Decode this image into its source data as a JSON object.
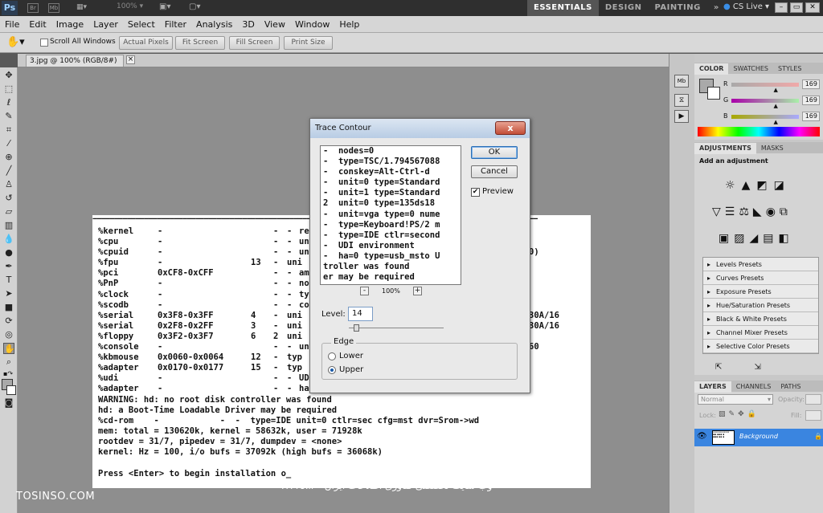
{
  "appbar": {
    "logo": "Ps",
    "zoom": "100%",
    "workspaces": [
      "ESSENTIALS",
      "DESIGN",
      "PAINTING"
    ],
    "more": "»",
    "cslive": "CS Live"
  },
  "menu": [
    "File",
    "Edit",
    "Image",
    "Layer",
    "Select",
    "Filter",
    "Analysis",
    "3D",
    "View",
    "Window",
    "Help"
  ],
  "options": {
    "scroll_all": "Scroll All Windows",
    "buttons": [
      "Actual Pixels",
      "Fit Screen",
      "Fill Screen",
      "Print Size"
    ]
  },
  "doc_tab": {
    "title": "3.jpg @ 100% (RGB/8#)",
    "close": "×"
  },
  "color_panel": {
    "tabs": [
      "COLOR",
      "SWATCHES",
      "STYLES"
    ],
    "channels": [
      {
        "label": "R",
        "value": "169",
        "pos": 0.66
      },
      {
        "label": "G",
        "value": "169",
        "pos": 0.66
      },
      {
        "label": "B",
        "value": "169",
        "pos": 0.66
      }
    ]
  },
  "adjustments": {
    "tabs": [
      "ADJUSTMENTS",
      "MASKS"
    ],
    "heading": "Add an adjustment",
    "presets": [
      "Levels Presets",
      "Curves Presets",
      "Exposure Presets",
      "Hue/Saturation Presets",
      "Black & White Presets",
      "Channel Mixer Presets",
      "Selective Color Presets"
    ]
  },
  "layers": {
    "tabs": [
      "LAYERS",
      "CHANNELS",
      "PATHS"
    ],
    "blend_mode": "Normal",
    "opacity_label": "Opacity:",
    "lock_label": "Lock:",
    "fill_label": "Fill:",
    "layer_name": "Background"
  },
  "terminal": {
    "rows": [
      [
        "%kernel",
        "-",
        "",
        "-",
        "-",
        "rel"
      ],
      [
        "%cpu",
        "-",
        "",
        "-",
        "-",
        "uni"
      ],
      [
        "%cpuid",
        "-",
        "",
        "-",
        "-",
        "uni"
      ],
      [
        "%fpu",
        "-",
        "13",
        "-",
        "uni"
      ],
      [
        "%pci",
        "0xCF8-0xCFF",
        "",
        "-",
        "-",
        "am="
      ],
      [
        "%PnP",
        "-",
        "",
        "-",
        "-",
        "nod"
      ],
      [
        "%clock",
        "-",
        "",
        "-",
        "-",
        "typ"
      ],
      [
        "%scodb",
        "-",
        "",
        "-",
        "-",
        "con"
      ],
      [
        "%serial",
        "0x3F8-0x3FF",
        "4",
        "-",
        "uni"
      ],
      [
        "%serial",
        "0x2F8-0x2FF",
        "3",
        "-",
        "uni"
      ],
      [
        "%floppy",
        "0x3F2-0x3F7",
        "6",
        "2",
        "uni"
      ],
      [
        "%console",
        "-",
        "",
        "-",
        "-",
        "uni"
      ],
      [
        "%kbmouse",
        "0x0060-0x0064",
        "12",
        "-",
        "typ"
      ],
      [
        "%adapter",
        "0x0170-0x0177",
        "15",
        "-",
        "typ"
      ],
      [
        "%udi",
        "-",
        "",
        "-",
        "-",
        "UDI"
      ],
      [
        "%adapter",
        "-",
        "",
        "-",
        "-",
        "ha="
      ]
    ],
    "right_col": [
      "",
      "",
      "0)",
      "",
      "",
      "",
      "",
      "",
      "30A/16",
      "30A/16",
      "",
      "60",
      "",
      "",
      "",
      ""
    ],
    "lines": [
      "WARNING: hd: no root disk controller was found",
      "hd: a Boot-Time Loadable Driver may be required",
      "%cd-rom    -            -  -  type=IDE unit=0 ctlr=sec cfg=mst dvr=Srom->wd",
      "mem: total = 130620k, kernel = 58632k, user = 71928k",
      "rootdev = 31/7, pipedev = 31/7, dumpdev = <none>",
      "kernel: Hz = 100, i/o bufs = 37092k (high bufs = 36068k)",
      "",
      "Press <Enter> to begin installation o_"
    ]
  },
  "watermark": {
    "left": "TOSINSO.COM",
    "right": "وب سایت تخصصی فناوری اطلاعات ایران - ITPro.ir"
  },
  "dialog": {
    "title": "Trace Contour",
    "close": "x",
    "ok": "OK",
    "cancel": "Cancel",
    "preview_label": "Preview",
    "preview_lines": [
      "-  nodes=0",
      "-  type=TSC/1.794567088",
      "-  conskey=Alt-Ctrl-d",
      "-  unit=0 type=Standard",
      "-  unit=1 type=Standard",
      "2  unit=0 type=135ds18",
      "-  unit=vga type=0 nume",
      "-  type=Keyboard!PS/2 m",
      "-  type=IDE ctlr=second",
      "-  UDI environment",
      "-  ha=0 type=usb_msto U",
      "troller was found",
      "er may be required"
    ],
    "zoom": "100%",
    "minus": "-",
    "plus": "+",
    "level_label": "Level:",
    "level_value": "14",
    "level_fraction": 0.05,
    "edge_label": "Edge",
    "lower": "Lower",
    "upper": "Upper"
  }
}
